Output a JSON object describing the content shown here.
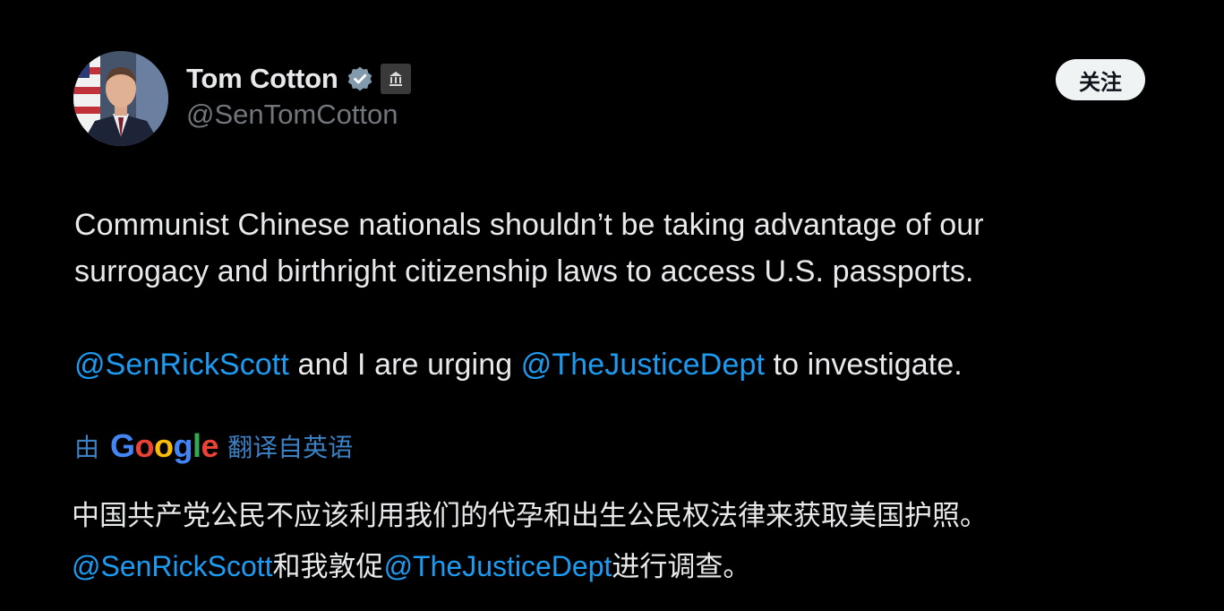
{
  "colors": {
    "background": "#000000",
    "text": "#e7e9ea",
    "secondary_text": "#71767b",
    "link": "#1d9bf0",
    "verified": "#829aab"
  },
  "author": {
    "display_name": "Tom Cotton",
    "handle": "@SenTomCotton",
    "badges": [
      "verified-icon",
      "government-building-icon"
    ]
  },
  "follow_button": {
    "label": "关注"
  },
  "tweet": {
    "line1": "Communist Chinese nationals shouldn’t be taking advantage of our",
    "line2": "surrogacy and birthright citizenship laws to access U.S. passports.",
    "mention1": "@SenRickScott",
    "middle": " and I are urging ",
    "mention2": "@TheJusticeDept",
    "end": " to investigate."
  },
  "translate_bar": {
    "prefix": "由",
    "provider_letters": [
      "G",
      "o",
      "o",
      "g",
      "l",
      "e"
    ],
    "suffix": "翻译自英语"
  },
  "translation": {
    "line1": "中国共产党公民不应该利用我们的代孕和出生公民权法律来获取美国护照。",
    "mention1": "@SenRickScott",
    "middle": "和我敦促",
    "mention2": "@TheJusticeDept",
    "end": "进行调查。"
  }
}
